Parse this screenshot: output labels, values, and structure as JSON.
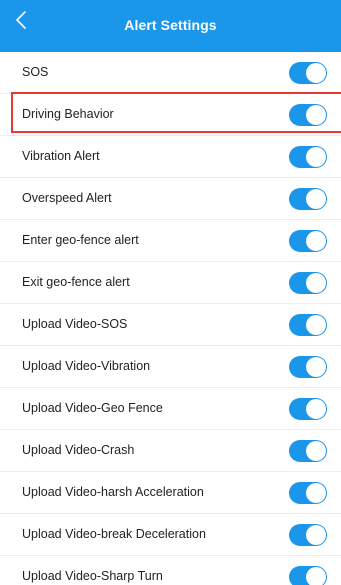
{
  "header": {
    "title": "Alert Settings",
    "back_icon": "chevron-left-icon",
    "background_color": "#1a96ea"
  },
  "settings": [
    {
      "label": "SOS",
      "enabled": true
    },
    {
      "label": "Driving Behavior",
      "enabled": true,
      "highlighted": true
    },
    {
      "label": "Vibration Alert",
      "enabled": true
    },
    {
      "label": "Overspeed Alert",
      "enabled": true
    },
    {
      "label": "Enter geo-fence alert",
      "enabled": true
    },
    {
      "label": "Exit geo-fence alert",
      "enabled": true
    },
    {
      "label": "Upload Video-SOS",
      "enabled": true
    },
    {
      "label": "Upload Video-Vibration",
      "enabled": true
    },
    {
      "label": "Upload Video-Geo Fence",
      "enabled": true
    },
    {
      "label": "Upload Video-Crash",
      "enabled": true
    },
    {
      "label": "Upload Video-harsh Acceleration",
      "enabled": true
    },
    {
      "label": "Upload Video-break Deceleration",
      "enabled": true
    },
    {
      "label": "Upload Video-Sharp Turn",
      "enabled": true
    }
  ],
  "colors": {
    "accent": "#1a96ea",
    "highlight_border": "#e53935"
  }
}
